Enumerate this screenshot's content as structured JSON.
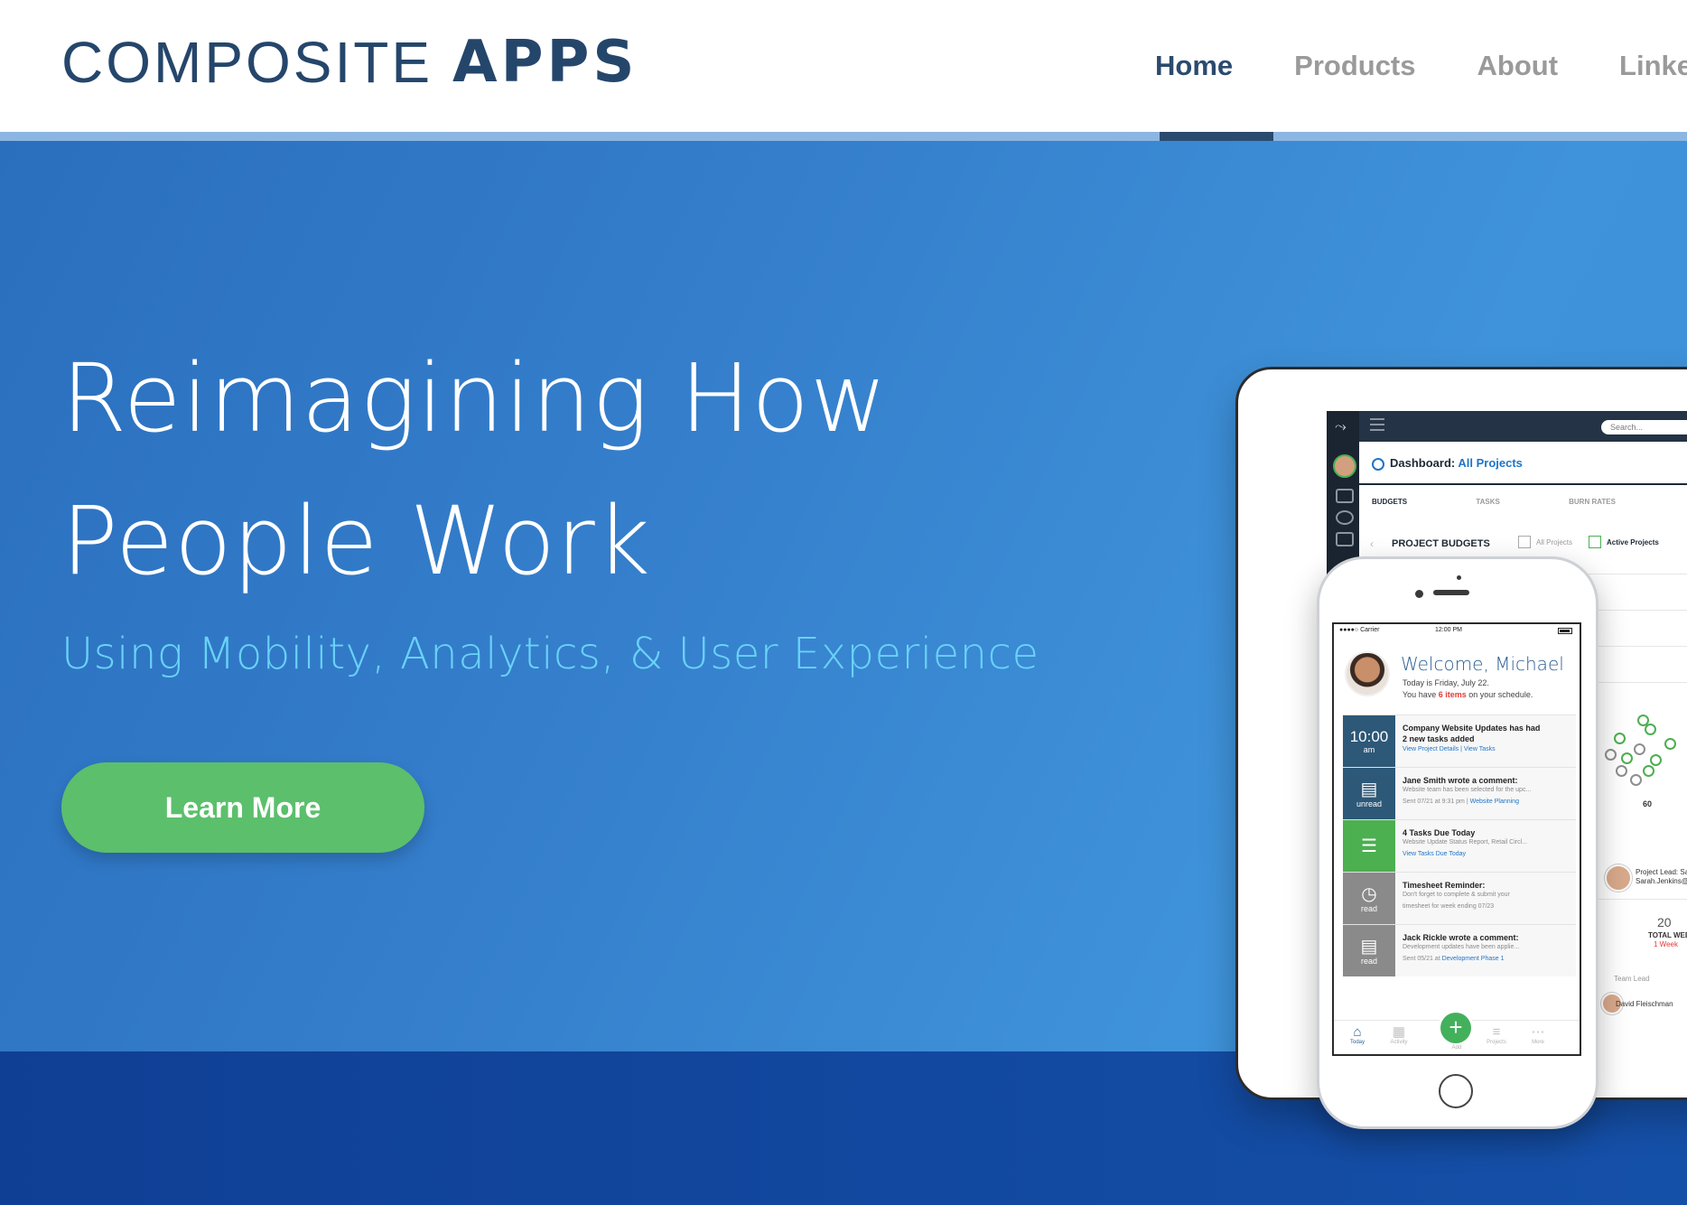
{
  "header": {
    "logo_light": "COMPOSITE",
    "logo_bold": "APPS",
    "nav": [
      {
        "label": "Home",
        "active": true
      },
      {
        "label": "Products",
        "active": false
      },
      {
        "label": "About",
        "active": false
      },
      {
        "label": "Linke",
        "active": false
      }
    ]
  },
  "hero": {
    "title_line1": "Reimagining How",
    "title_line2": "People Work",
    "subtitle": "Using Mobility, Analytics, & User Experience",
    "cta_label": "Learn More"
  },
  "tablet": {
    "search_placeholder": "Search...",
    "breadcrumb_prefix": "Dashboard:",
    "breadcrumb_link": "All Projects",
    "tabs": [
      "BUDGETS",
      "TASKS",
      "BURN RATES"
    ],
    "section_title": "PROJECT BUDGETS",
    "filter_all": "All Projects",
    "filter_active": "Active Projects",
    "axis_tick": "60",
    "project_lead_label": "Project Lead: Sara",
    "project_lead_email": "Sarah.Jenkins@co",
    "stat_value": "20",
    "stat_label": "TOTAL WEE",
    "stat_alert": "1 Week",
    "team_lead_label": "Team Lead",
    "team_member": "David Fleischman"
  },
  "phone": {
    "carrier": "●●●●○ Carrier",
    "time": "12:00 PM",
    "welcome": "Welcome, Michael",
    "date_line": "Today is Friday, July 22.",
    "items_prefix": "You have",
    "items_count": "6 items",
    "items_suffix": "on your schedule.",
    "feed": [
      {
        "tile_main": "10:00",
        "tile_sub": "am",
        "title": "Company Website Updates has had",
        "desc": "2 new tasks added",
        "meta_link": "View Project Details | View Tasks",
        "color": "#2d5878"
      },
      {
        "tile_icon": "comment-icon",
        "tile_sub": "unread",
        "title": "Jane Smith wrote a comment:",
        "desc": "Website team has been selected for the upc...",
        "meta": "Sent 07/21 at 9:31 pm |",
        "meta_link": "Website Planning",
        "color": "#2d5878"
      },
      {
        "tile_icon": "checklist-icon",
        "title": "4 Tasks Due Today",
        "desc": "Website Update Status Report, Retail Circl...",
        "meta_link": "View Tasks Due Today",
        "color": "#4caf50"
      },
      {
        "tile_icon": "clock-icon",
        "tile_sub": "read",
        "title": "Timesheet Reminder:",
        "desc": "Don't forget to complete & submit your",
        "meta": "timesheet for week ending 07/23",
        "color": "#8a8a8a"
      },
      {
        "tile_icon": "comment-icon",
        "tile_sub": "read",
        "title": "Jack Rickle wrote a comment:",
        "desc": "Development updates have been applie...",
        "meta": "Sent 05/21 at",
        "meta_link": "Development Phase 1",
        "color": "#8a8a8a"
      }
    ],
    "tabs": [
      "Today",
      "Activity",
      "Add",
      "Projects",
      "More"
    ],
    "colors": {
      "accent": "#2b5f94",
      "fab": "#43b05c"
    }
  },
  "colors": {
    "brand_dark": "#25466b",
    "cta_green": "#5cbf6c",
    "subtitle_cyan": "#69d2f7",
    "hero_blue": "#357fcc"
  }
}
